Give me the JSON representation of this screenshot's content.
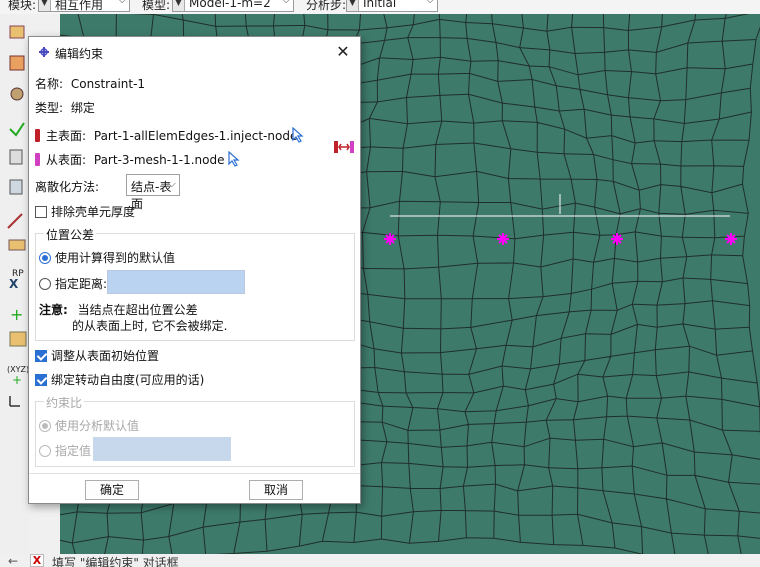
{
  "toolbar": {
    "module_label": "模块:",
    "module_value": "相互作用",
    "model_label": "模型:",
    "model_value": "Model-1-m=2",
    "step_label": "分析步:",
    "step_value": "Initial"
  },
  "dialog": {
    "title": "编辑约束",
    "name_label": "名称:",
    "name_value": "Constraint-1",
    "type_label": "类型:",
    "type_value": "绑定",
    "master_label": "主表面:",
    "master_value": "Part-1-allElemEdges-1.inject-node",
    "slave_label": "从表面:",
    "slave_value": "Part-3-mesh-1-1.node",
    "discretization_label": "离散化方法:",
    "discretization_value": "结点-表面",
    "exclude_shell_label": "排除壳单元厚度",
    "exclude_shell_checked": false,
    "position_tolerance": {
      "title": "位置公差",
      "option_computed": "使用计算得到的默认值",
      "option_specify": "指定距离:",
      "distance_value": "",
      "note_label": "注意:",
      "note_line1": "当结点在超出位置公差",
      "note_line2": "的从表面上时, 它不会被绑定."
    },
    "adjust_slave_label": "调整从表面初始位置",
    "adjust_slave_checked": true,
    "tie_rotation_label": "绑定转动自由度(可应用的话)",
    "tie_rotation_checked": true,
    "constraint_ratio": {
      "title": "约束比",
      "option_default": "使用分析默认值",
      "option_specify": "指定值",
      "value": ""
    },
    "ok_label": "确定",
    "cancel_label": "取消"
  },
  "statusbar": {
    "prompt": "填写 \"编辑约束\" 对话框"
  },
  "colors": {
    "mesh_fill": "#3e7a6a",
    "mesh_line": "#1f2f2a",
    "node_marker": "#ff00ff",
    "accent": "#2a6fd3",
    "master_marker": "#c0202a",
    "slave_marker": "#d040c0"
  }
}
